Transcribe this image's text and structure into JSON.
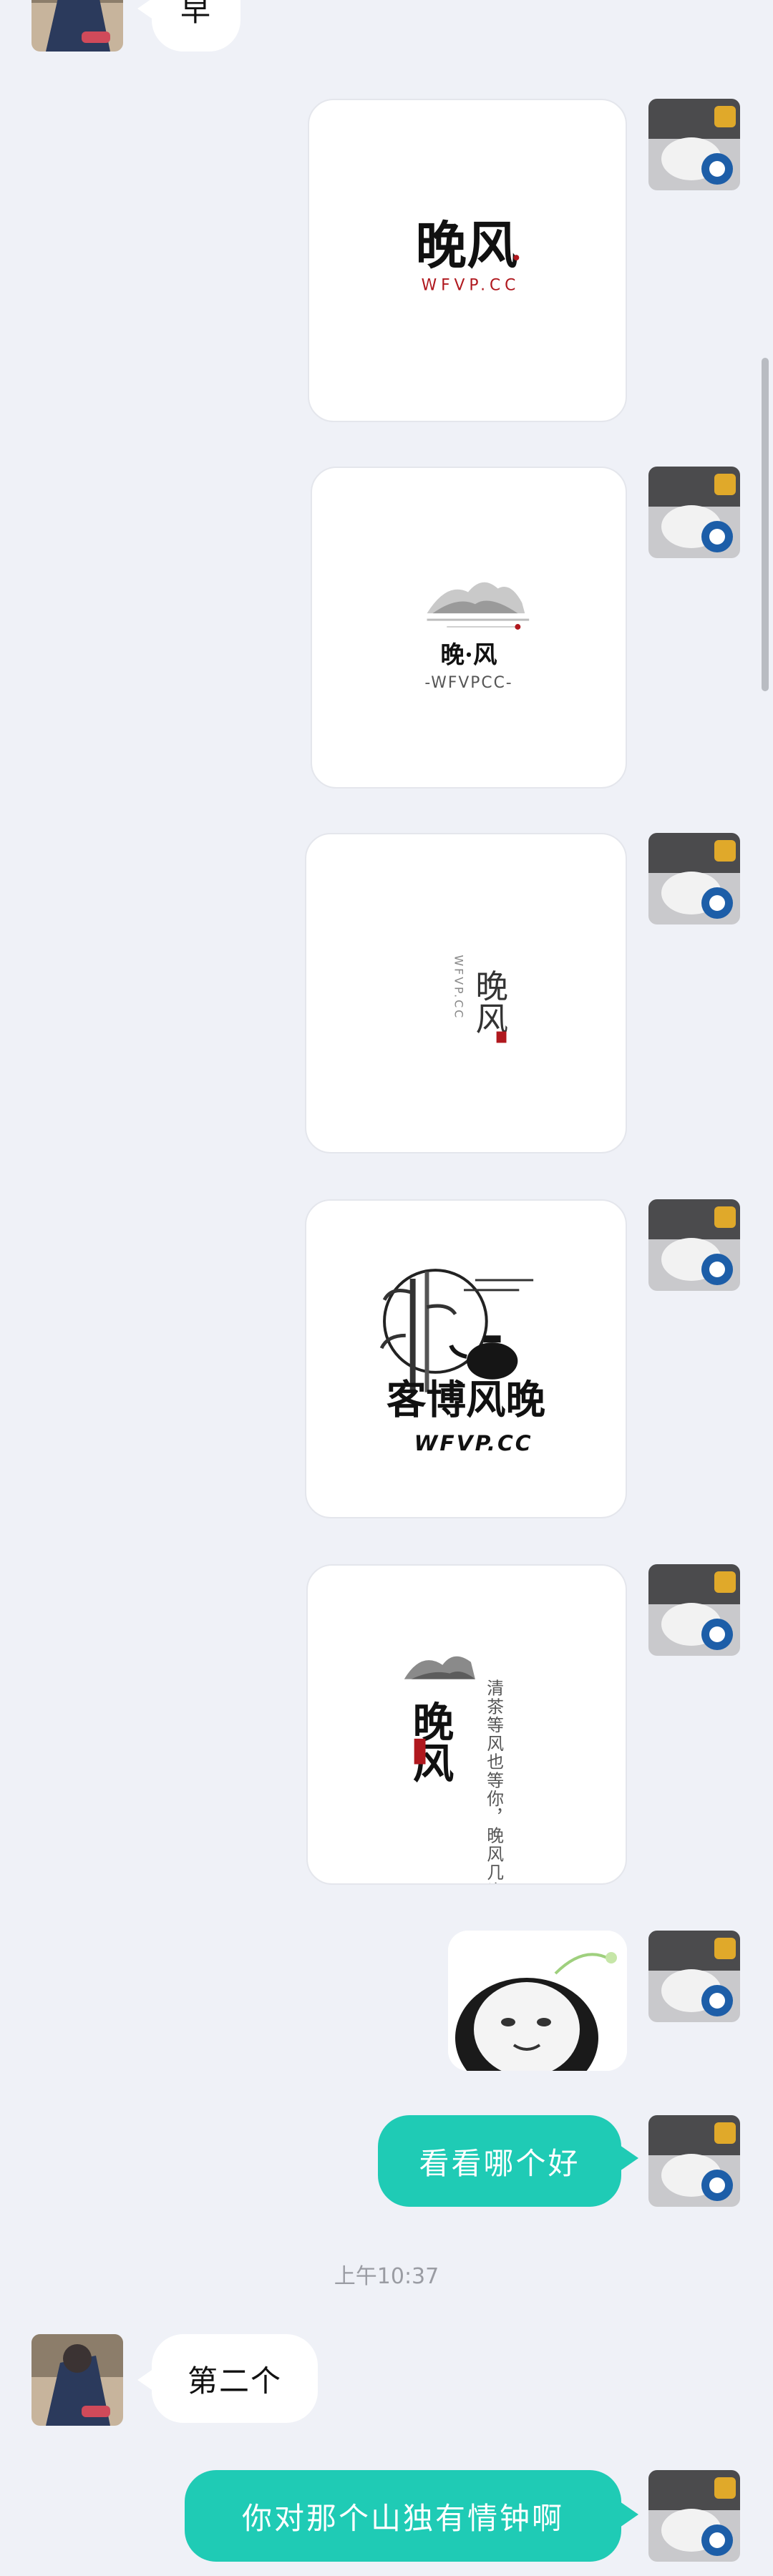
{
  "conversation": {
    "top_reply": "早",
    "cards": [
      {
        "logo_title": "晚风",
        "logo_sub": "WFVP.CC"
      },
      {
        "logo_title": "晚·风",
        "logo_sub": "-WFVPCC-"
      },
      {
        "logo_title": "晚风",
        "logo_sub": "WFVP.CC"
      },
      {
        "logo_title": "客博风晚",
        "logo_sub": "WFVP.CC"
      },
      {
        "logo_title": "晚风",
        "logo_sub": "清茶等风也等你，晚风几许撩人意"
      }
    ],
    "sent_message_1": "看看哪个好",
    "timestamp": "上午10:37",
    "received_message": "第二个",
    "sent_message_2": "你对那个山独有情钟啊"
  },
  "colors": {
    "background": "#eff1f7",
    "outgoing_bubble": "#1fcbb5",
    "incoming_bubble": "#ffffff",
    "logo_red": "#b0181e"
  }
}
